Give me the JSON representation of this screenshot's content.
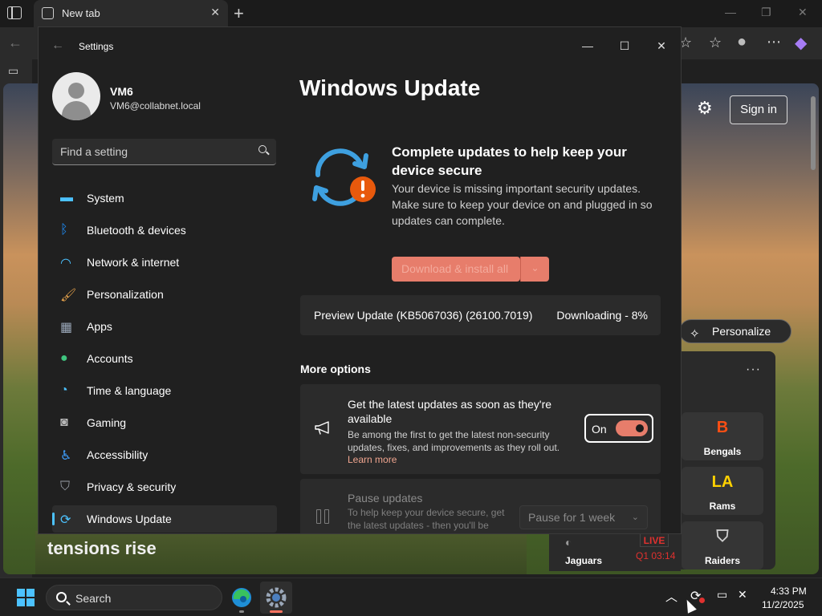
{
  "browser": {
    "tab_title": "New tab",
    "tab_close": "✕",
    "new_tab": "+",
    "signin_label": "Sign in",
    "personalize_label": "Personalize",
    "more_dots": "···",
    "news_headline": "tensions rise",
    "live_badge": "LIVE",
    "game_clock": "Q1 03:14",
    "teams": [
      "Bengals",
      "Rams",
      "Raiders",
      "Jaguars"
    ]
  },
  "settings": {
    "app_title": "Settings",
    "user": {
      "name": "VM6",
      "email": "VM6@collabnet.local"
    },
    "search_placeholder": "Find a setting",
    "nav": [
      {
        "label": "System",
        "icon": "monitor-icon",
        "color": "#4cc2ff"
      },
      {
        "label": "Bluetooth & devices",
        "icon": "bluetooth-icon",
        "color": "#1e90ff"
      },
      {
        "label": "Network & internet",
        "icon": "wifi-icon",
        "color": "#4cc2ff"
      },
      {
        "label": "Personalization",
        "icon": "brush-icon",
        "color": "#e8a44c"
      },
      {
        "label": "Apps",
        "icon": "apps-icon",
        "color": "#9aa7b8"
      },
      {
        "label": "Accounts",
        "icon": "person-icon",
        "color": "#3fc57f"
      },
      {
        "label": "Time & language",
        "icon": "globe-clock-icon",
        "color": "#4cc2ff"
      },
      {
        "label": "Gaming",
        "icon": "gamepad-icon",
        "color": "#b7b7b7"
      },
      {
        "label": "Accessibility",
        "icon": "accessibility-icon",
        "color": "#3fa0ff"
      },
      {
        "label": "Privacy & security",
        "icon": "shield-icon",
        "color": "#9aa0a8"
      },
      {
        "label": "Windows Update",
        "icon": "refresh-icon",
        "color": "#4cc2ff"
      }
    ],
    "active_nav": "Windows Update",
    "page_title": "Windows Update",
    "alert": {
      "heading": "Complete updates to help keep your device secure",
      "body": "Your device is missing important security updates. Make sure to keep your device on and plugged in so updates can complete.",
      "download_button": "Download & install all",
      "split_chevron": "⌄"
    },
    "preview_update": {
      "name": "Preview Update (KB5067036) (26100.7019)",
      "status": "Downloading - 8%",
      "progress_percent": 8
    },
    "more_options_heading": "More options",
    "latest_updates": {
      "title": "Get the latest updates as soon as they're available",
      "description": "Be among the first to get the latest non-security updates, fixes, and improvements as they roll out.",
      "learn_more": "Learn more",
      "toggle_label": "On",
      "toggle_on": true
    },
    "pause_updates": {
      "title": "Pause updates",
      "description": "To help keep your device secure, get the latest updates - then you'll be able to pause again.",
      "select_value": "Pause for 1 week"
    }
  },
  "taskbar": {
    "search_label": "Search",
    "time": "4:33 PM",
    "date": "11/2/2025"
  },
  "colors": {
    "accent": "#4cc2ff",
    "update_accent": "#e77d6b",
    "alert_orange": "#e8590c",
    "live_red": "#e0312f"
  }
}
